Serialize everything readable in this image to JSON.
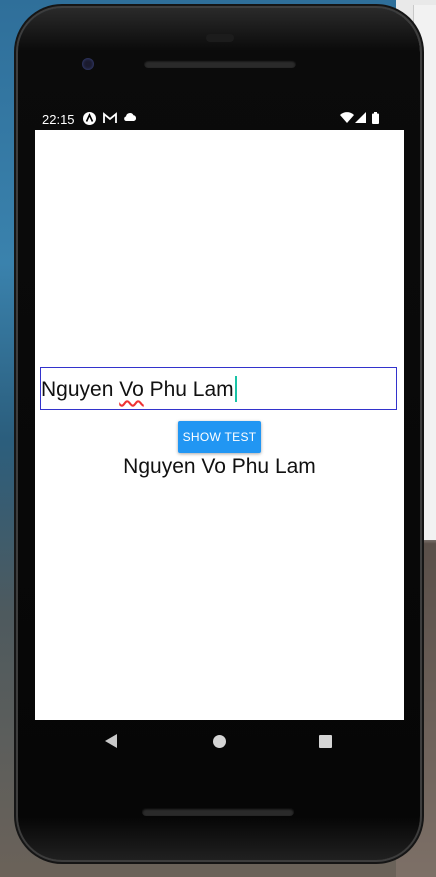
{
  "status_bar": {
    "time": "22:15",
    "left_icons": [
      "app-icon",
      "gmail-icon",
      "cloud-icon"
    ],
    "right_icons": [
      "wifi-icon",
      "signal-icon",
      "battery-icon"
    ]
  },
  "input": {
    "value_before": "Nguyen ",
    "value_misspelled": "Vo",
    "value_after": " Phu Lam"
  },
  "button": {
    "label": "SHOW TEST"
  },
  "output": {
    "text": "Nguyen Vo Phu Lam"
  },
  "nav": {
    "icons": [
      "back-icon",
      "home-icon",
      "recents-icon"
    ]
  },
  "colors": {
    "button": "#2196f3",
    "input_border": "#3333cc",
    "caret": "#19c3a6",
    "spellcheck": "#e33"
  }
}
